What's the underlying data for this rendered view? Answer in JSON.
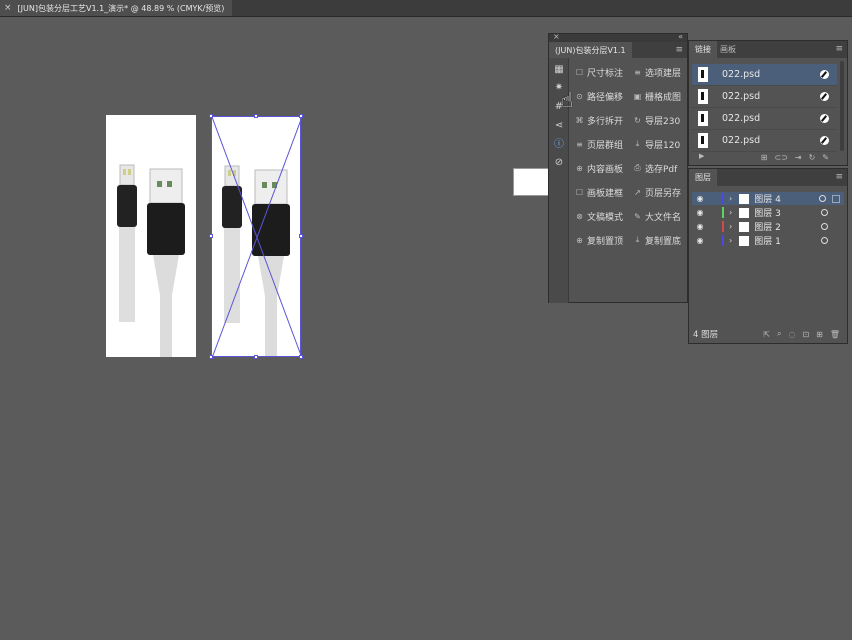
{
  "document_tab": {
    "close": "×",
    "title": "[JUN]包装分层工艺V1.1_演示* @ 48.89 % (CMYK/预览)"
  },
  "plugin_panel": {
    "title": "(JUN)包装分层V1.1",
    "collapse": "«",
    "close": "×",
    "menu": "≡",
    "rail_icons": [
      "grid-icon",
      "sun-icon",
      "hash-icon",
      "share-icon",
      "info-icon",
      "link-icon"
    ],
    "buttons": [
      {
        "icon": "☐",
        "label": "尺寸标注"
      },
      {
        "icon": "≡",
        "label": "选项建层"
      },
      {
        "icon": "⊙",
        "label": "路径偏移"
      },
      {
        "icon": "▣",
        "label": "栅格成图"
      },
      {
        "icon": "⌘",
        "label": "多行拆开"
      },
      {
        "icon": "↻",
        "label": "导层230"
      },
      {
        "icon": "≡",
        "label": "页层群组"
      },
      {
        "icon": "⤓",
        "label": "导层120"
      },
      {
        "icon": "⊕",
        "label": "内容画板"
      },
      {
        "icon": "⎙",
        "label": "选存Pdf"
      },
      {
        "icon": "☐",
        "label": "画板建框"
      },
      {
        "icon": "↗",
        "label": "页层另存"
      },
      {
        "icon": "⊗",
        "label": "文稿模式"
      },
      {
        "icon": "✎",
        "label": "大文件名"
      },
      {
        "icon": "⊕",
        "label": "复制置顶"
      },
      {
        "icon": "⤓",
        "label": "复制置底"
      }
    ]
  },
  "links_panel": {
    "tabs": [
      "链接",
      "画板"
    ],
    "active_tab": "链接",
    "collapse": "«",
    "menu": "≡",
    "files": [
      "022.psd",
      "022.psd",
      "022.psd",
      "022.psd"
    ],
    "selected_index": 0,
    "footer_icons": [
      "place-icon",
      "relink-icon",
      "goto-icon",
      "update-icon",
      "edit-icon"
    ],
    "footer_glyphs": [
      "⊞",
      "⊂⊃",
      "⇥",
      "↻",
      "✎"
    ],
    "play": "▶"
  },
  "layers_panel": {
    "tab": "图层",
    "menu": "≡",
    "layers": [
      {
        "name": "图层 4",
        "color": "#4a4ae0"
      },
      {
        "name": "图层 3",
        "color": "#5fd25f"
      },
      {
        "name": "图层 2",
        "color": "#d04a4a"
      },
      {
        "name": "图层 1",
        "color": "#4a4ae0"
      }
    ],
    "selected_index": 0,
    "count_label": "4 图层",
    "footer_glyphs": [
      "⇱",
      "⌕",
      "◌",
      "⊡",
      "⊞",
      "🗑"
    ]
  }
}
